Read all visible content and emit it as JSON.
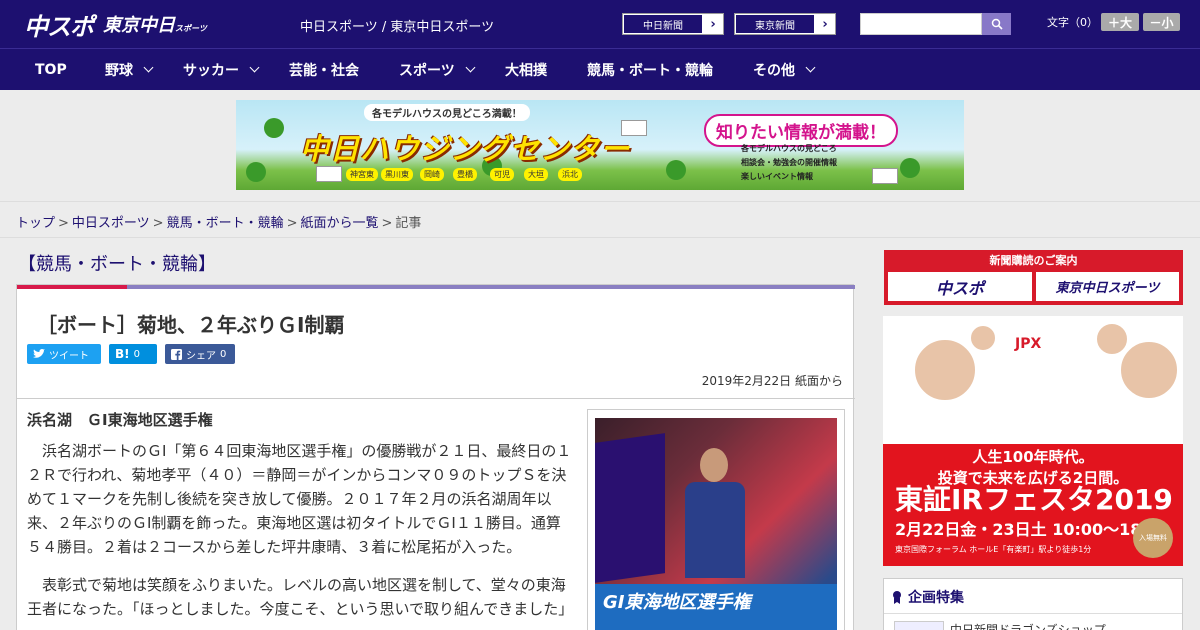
{
  "header": {
    "logo_main": "中スポ",
    "logo_sub": "東京中日",
    "logo_sub_small": "スポーツ",
    "site_title": "中日スポーツ / 東京中日スポーツ",
    "links": [
      {
        "label": "中日新聞"
      },
      {
        "label": "東京新聞"
      }
    ],
    "search_placeholder": "",
    "fontsize_label": "文字（0）",
    "fontsize_up": "＋大",
    "fontsize_down": "－小"
  },
  "nav": [
    {
      "label": "TOP",
      "has_menu": false
    },
    {
      "label": "野球",
      "has_menu": true
    },
    {
      "label": "サッカー",
      "has_menu": true
    },
    {
      "label": "芸能・社会",
      "has_menu": false
    },
    {
      "label": "スポーツ",
      "has_menu": true
    },
    {
      "label": "大相撲",
      "has_menu": false
    },
    {
      "label": "競馬・ボート・競輪",
      "has_menu": false
    },
    {
      "label": "その他",
      "has_menu": true
    }
  ],
  "ad_banner": {
    "tagline": "各モデルハウスの見どころ満載！",
    "headline": "中日ハウジングセンター",
    "bubble": "知りたい情報が満載！",
    "cities": [
      "神宮東",
      "黒川東",
      "岡崎",
      "豊橋",
      "可児",
      "大垣",
      "浜北"
    ],
    "features": [
      "各モデルハウスの見どころ",
      "相談会・勉強会の開催情報",
      "楽しいイベント情報"
    ]
  },
  "breadcrumb": [
    "トップ",
    "中日スポーツ",
    "競馬・ボート・競輪",
    "紙面から一覧",
    "記事"
  ],
  "article": {
    "category": "【競馬・ボート・競輪】",
    "headline": "［ボート］菊地、２年ぶりＧⅠ制覇",
    "share": {
      "tweet": "ツイート",
      "hatena": "B!",
      "hatena_count": "0",
      "facebook": "シェア",
      "facebook_count": "0"
    },
    "date": "2019年2月22日 紙面から",
    "subhead": "浜名湖　ＧⅠ東海地区選手権",
    "paragraphs": [
      "浜名湖ボートのＧⅠ「第６４回東海地区選手権」の優勝戦が２１日、最終日の１２Ｒで行われ、菊地孝平（４０）＝静岡＝がインからコンマ０９のトップＳを決めて１マークを先制し後続を突き放して優勝。２０１７年２月の浜名湖周年以来、２年ぶりのＧⅠ制覇を飾った。東海地区選は初タイトルでＧⅠ１１勝目。通算５４勝目。２着は２コースから差した坪井康晴、３着に松尾拓が入った。",
      "表彰式で菊地は笑顔をふりまいた。レベルの高い地区選を制して、堂々の東海王者になった。「ほっとしました。今度こそ、という思いで取り組んできました」"
    ],
    "photo_banner": "GⅠ東海地区選手権"
  },
  "sidebar": {
    "subscription_label": "新聞購読のご案内",
    "subscription_items": [
      "中スポ",
      "東京中日スポーツ"
    ],
    "ad": {
      "brand": "JPX",
      "line1": "人生100年時代。",
      "line2": "投資で未来を広げる2日間。",
      "line3": "東証IRフェスタ2019",
      "line4": "2月22日金・23日土 10:00～18:00",
      "line5": "東京国際フォーラム ホールE「有楽町」駅より徒歩1分",
      "badge": "入場無料"
    },
    "feature_title": "企画特集",
    "feature_item": "中日新聞ドラゴンズショップ"
  },
  "colors": {
    "brand_navy": "#1d1070",
    "accent_red": "#d71a4a",
    "twitter": "#1da1f2",
    "hatena": "#008fde",
    "facebook": "#3b5998"
  }
}
